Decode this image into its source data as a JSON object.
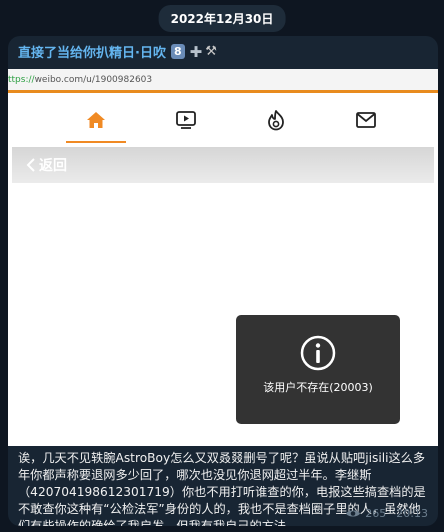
{
  "date_label": "2022年12月30日",
  "post": {
    "channel_title": "直接了当给你扒精日·日吹",
    "badge": "8",
    "title_suffix_icons": [
      "plus-icon",
      "hammer-pick-icon"
    ],
    "text": "诶，几天不见轶腕AstroBoy怎么又双叒叕删号了呢？虽说从贴吧jisili这么多年你都声称要退网多少回了，哪次也没见你退网超过半年。李继斯（420704198612301719）你也不用打听谁查的你，电报这些搞查档的是不敢查你这种有“公检法军”身份的人的，我也不是查档圈子里的人，虽然他们有些操作的确给了我启发，但我有我自己的方法。",
    "views": "265",
    "time": "20:13"
  },
  "screenshot": {
    "url_scheme": "ttps://",
    "url_rest": "weibo.com/u/1900982603",
    "nav_icons": [
      "home-icon",
      "video-icon",
      "fire-icon",
      "mail-icon"
    ],
    "back_label": "返回",
    "error_message": "该用户不存在(20003)"
  },
  "colors": {
    "page_bg": "#0e1621",
    "bubble_bg": "#182533",
    "link_blue": "#64b5ef",
    "accent_orange": "#f08a24",
    "toast_bg": "#333333"
  }
}
